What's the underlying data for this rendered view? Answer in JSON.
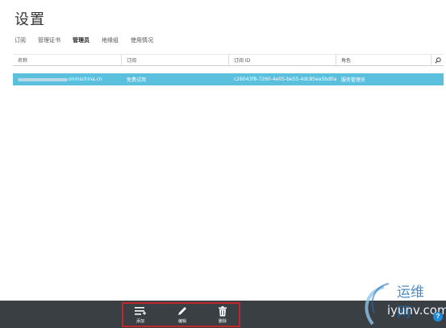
{
  "page": {
    "title": "设置"
  },
  "tabs": [
    {
      "label": "订阅"
    },
    {
      "label": "管理证书"
    },
    {
      "label": "管理员"
    },
    {
      "label": "地缘组"
    },
    {
      "label": "使用情况"
    }
  ],
  "active_tab_index": 2,
  "table": {
    "headers": [
      "名称",
      "订阅",
      "订阅 ID",
      "角色"
    ],
    "rows": [
      {
        "name_suffix": "onmschina.cn",
        "subscription": "免费试用",
        "subscription_id": "c26043f8-7260-4e05-be55-4dc85ea5bd0a",
        "role": "服务管理员"
      }
    ]
  },
  "commands": [
    {
      "label": "添加",
      "icon": "add-list-icon"
    },
    {
      "label": "编辑",
      "icon": "pencil-icon"
    },
    {
      "label": "删除",
      "icon": "trash-icon"
    }
  ],
  "help": {
    "label": "?"
  },
  "watermark": {
    "cn": "运维网",
    "en": "iyunv.com"
  },
  "colors": {
    "selected_row": "#5bc0de",
    "bottom_bar": "#3a3f44",
    "highlight_box": "#c0282d",
    "help": "#1f8ad6"
  }
}
